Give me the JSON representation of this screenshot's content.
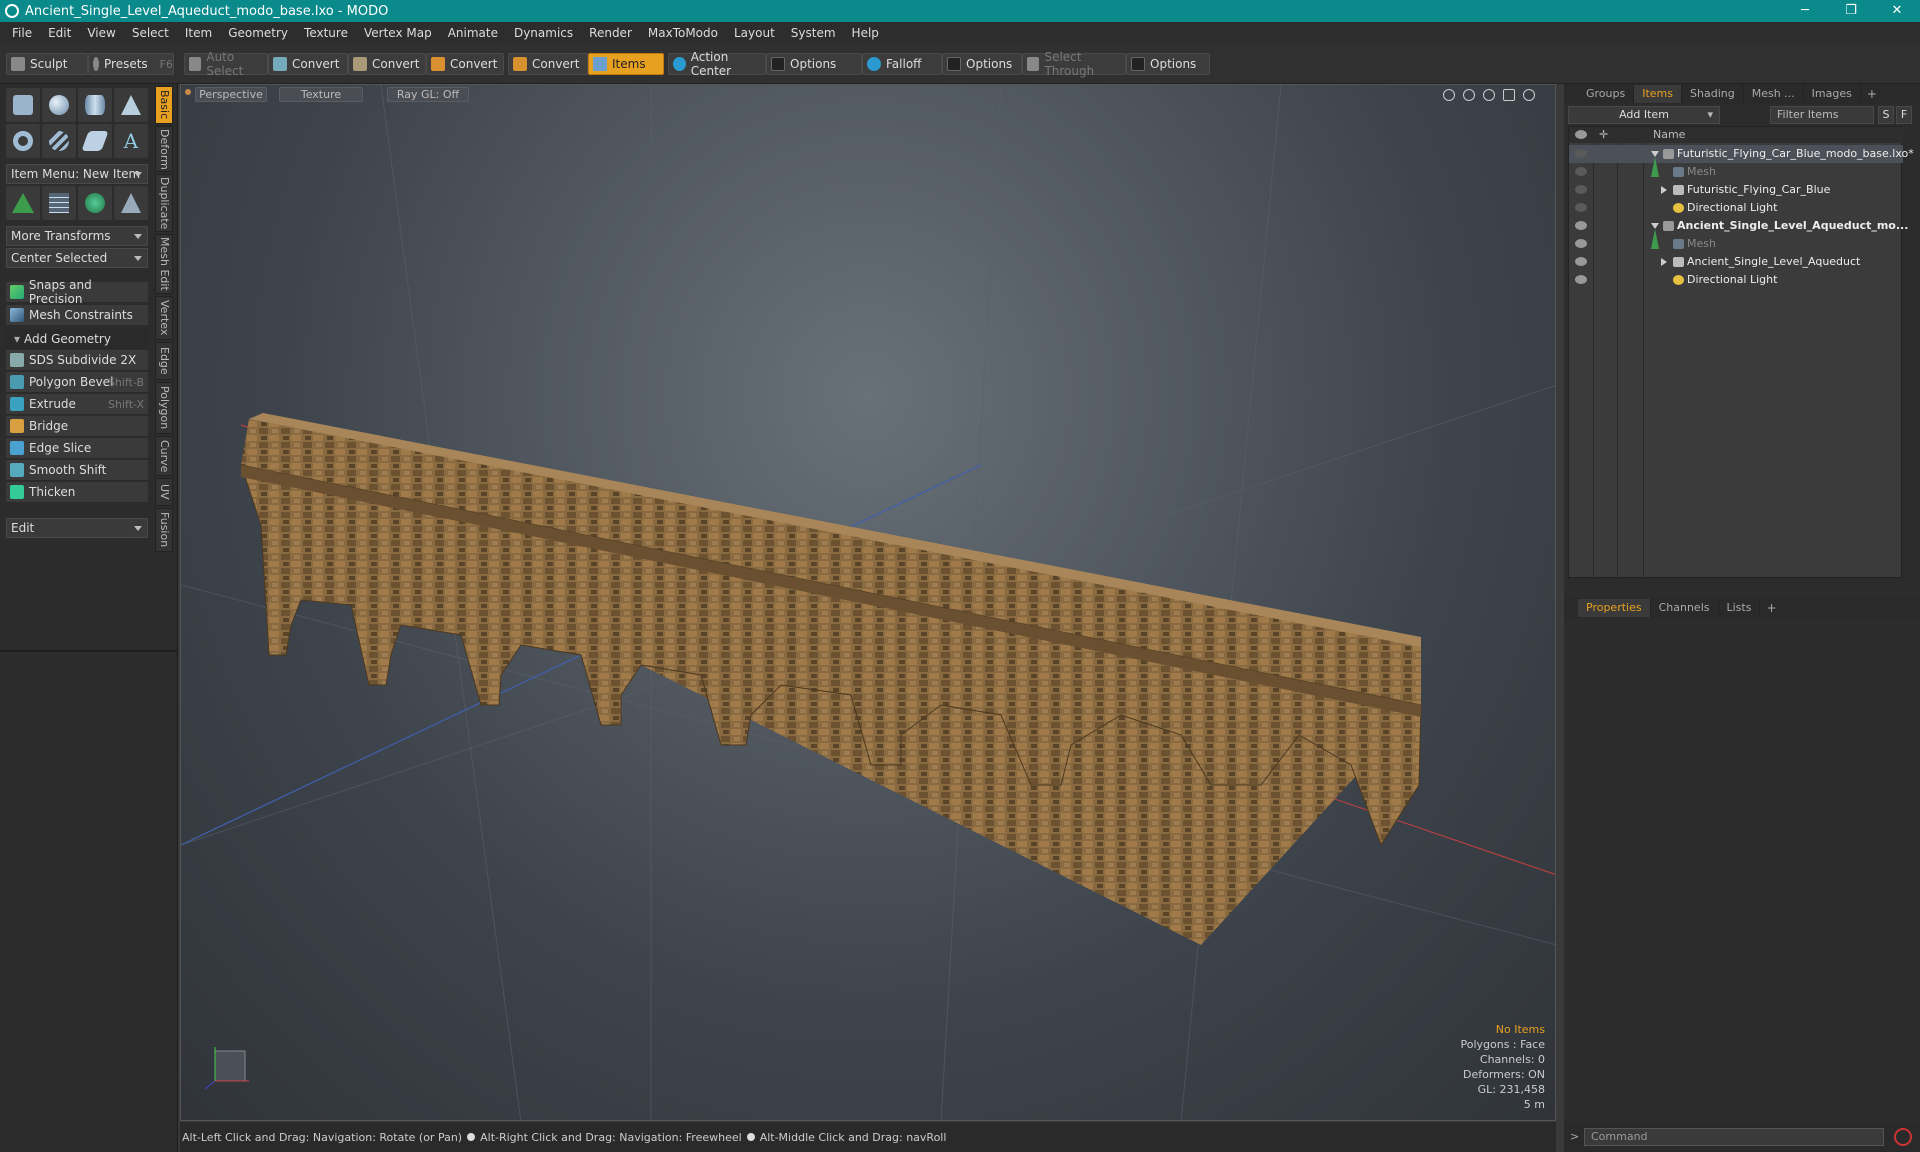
{
  "window": {
    "title": "Ancient_Single_Level_Aqueduct_modo_base.lxo - MODO",
    "min": "─",
    "max": "❐",
    "close": "✕"
  },
  "menu": [
    "File",
    "Edit",
    "View",
    "Select",
    "Item",
    "Geometry",
    "Texture",
    "Vertex Map",
    "Animate",
    "Dynamics",
    "Render",
    "MaxToModo",
    "Layout",
    "System",
    "Help"
  ],
  "toolbar": {
    "sculpt": "Sculpt",
    "presets": "Presets",
    "presets_key": "F6",
    "auto_select": "Auto Select",
    "convert1": "Convert",
    "convert2": "Convert",
    "convert3": "Convert",
    "convert4": "Convert",
    "items": "Items",
    "action_center": "Action Center",
    "options1": "Options",
    "falloff": "Falloff",
    "options2": "Options",
    "select_through": "Select Through",
    "options3": "Options"
  },
  "left": {
    "item_menu": "Item Menu: New Item",
    "more_transforms": "More Transforms",
    "center_selected": "Center Selected",
    "snaps": "Snaps and Precision",
    "mesh_constraints": "Mesh Constraints",
    "add_geometry": "Add Geometry",
    "tools": [
      {
        "label": "SDS Subdivide 2X",
        "key": ""
      },
      {
        "label": "Polygon Bevel",
        "key": "Shift-B"
      },
      {
        "label": "Extrude",
        "key": "Shift-X"
      },
      {
        "label": "Bridge",
        "key": ""
      },
      {
        "label": "Edge Slice",
        "key": ""
      },
      {
        "label": "Smooth Shift",
        "key": ""
      },
      {
        "label": "Thicken",
        "key": ""
      }
    ],
    "edit": "Edit",
    "vtabs": [
      "Basic",
      "Deform",
      "Duplicate",
      "Mesh Edit",
      "Vertex",
      "Edge",
      "Polygon",
      "Curve",
      "UV",
      "Fusion"
    ]
  },
  "viewport": {
    "perspective": "Perspective",
    "texture": "Texture",
    "raygl": "Ray GL: Off",
    "info": {
      "no_items": "No Items",
      "polygons": "Polygons : Face",
      "channels": "Channels: 0",
      "deformers": "Deformers: ON",
      "gl": "GL: 231,458",
      "scale": "5 m"
    }
  },
  "status": {
    "s1": "Alt-Left Click and Drag: Navigation: Rotate (or Pan)",
    "s2": "Alt-Right Click and Drag: Navigation: Freewheel",
    "s3": "Alt-Middle Click and Drag: navRoll"
  },
  "right": {
    "tabs": [
      "Groups",
      "Items",
      "Shading",
      "Mesh ...",
      "Images"
    ],
    "add_item": "Add Item",
    "filter": "Filter Items",
    "s_btn": "S",
    "f_btn": "F",
    "col_name": "Name",
    "rows": [
      {
        "label": "Futuristic_Flying_Car_Blue_modo_base.lxo*",
        "indent": 0
      },
      {
        "label": "Mesh",
        "indent": 1
      },
      {
        "label": "Futuristic_Flying_Car_Blue",
        "indent": 1
      },
      {
        "label": "Directional Light",
        "indent": 1
      },
      {
        "label": "Ancient_Single_Level_Aqueduct_mo...",
        "indent": 0
      },
      {
        "label": "Mesh",
        "indent": 1
      },
      {
        "label": "Ancient_Single_Level_Aqueduct",
        "indent": 1
      },
      {
        "label": "Directional Light",
        "indent": 1
      }
    ],
    "prop_tabs": [
      "Properties",
      "Channels",
      "Lists"
    ],
    "command": "Command"
  },
  "colors": {
    "accent": "#e8a020",
    "titlebar": "#0a8a8a",
    "stone": "#8a6a40"
  }
}
